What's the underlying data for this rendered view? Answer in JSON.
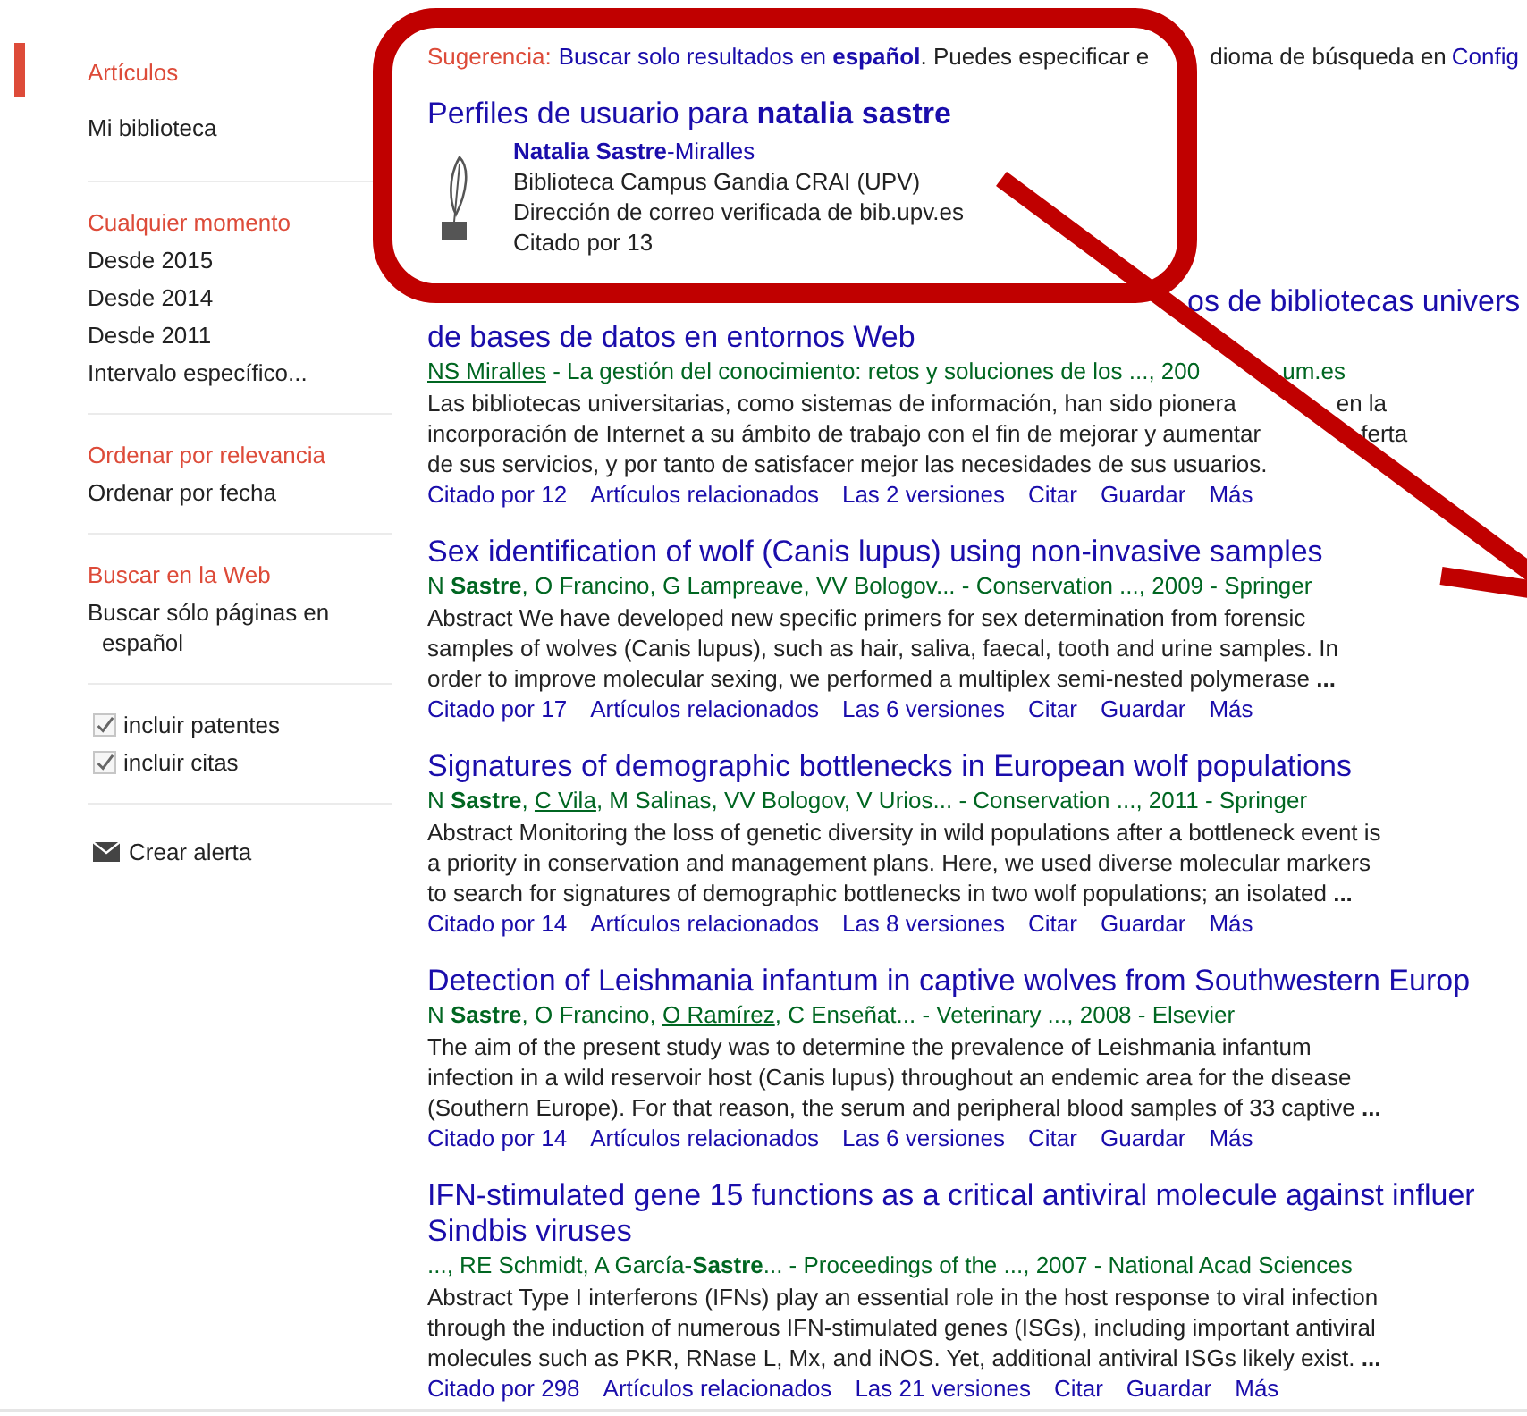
{
  "sidebar": {
    "groups": [
      {
        "items": [
          {
            "label": "Artículos",
            "selected": true
          },
          {
            "label": "Mi biblioteca",
            "selected": false
          }
        ]
      },
      {
        "items": [
          {
            "label": "Cualquier momento",
            "selected": true
          },
          {
            "label": "Desde 2015",
            "selected": false
          },
          {
            "label": "Desde 2014",
            "selected": false
          },
          {
            "label": "Desde 2011",
            "selected": false
          },
          {
            "label": "Intervalo específico...",
            "selected": false
          }
        ]
      },
      {
        "items": [
          {
            "label": "Ordenar por relevancia",
            "selected": true
          },
          {
            "label": "Ordenar por fecha",
            "selected": false
          }
        ]
      },
      {
        "items": [
          {
            "label": "Buscar en la Web",
            "selected": true
          },
          {
            "label": "Buscar sólo páginas en español",
            "selected": false
          }
        ]
      }
    ],
    "checkboxes": [
      {
        "label": "incluir patentes",
        "checked": true
      },
      {
        "label": "incluir citas",
        "checked": true
      }
    ],
    "alert": "Crear alerta"
  },
  "suggestion": {
    "label": "Sugerencia:",
    "link": "Buscar solo resultados en **español**",
    "text": ". Puedes especificar e",
    "text_after_mark": "dioma de búsqueda en",
    "settings_link": "Config"
  },
  "profiles": {
    "title": "Perfiles de usuario para **natalia sastre**",
    "name": "**Natalia Sastre**-Miralles",
    "lines": [
      "Biblioteca Campus Gandia CRAI (UPV)",
      "Dirección de correo verificada de bib.upv.es",
      "Citado por 13"
    ]
  },
  "results": [
    {
      "title_lines": [
        {
          "text": "os de bibliotecas univers",
          "covered": true
        },
        {
          "text": "de bases de datos en entornos Web",
          "covered": false
        }
      ],
      "authors": [
        {
          "kind": "link",
          "text": "NS Miralles"
        },
        {
          "kind": "plain",
          "text": " - La gestión del conocimiento: retos y soluciones de los ..., 200"
        },
        {
          "kind": "after_mark",
          "text": "um.es"
        }
      ],
      "snippet_lines": [
        [
          "Las bibliotecas universitarias, como sistemas de información, han sido pionera",
          "en la"
        ],
        [
          "incorporación de Internet a su ámbito de trabajo con el fin de mejorar y aumentar",
          "ferta"
        ],
        [
          "de sus servicios, y por tanto de satisfacer mejor las necesidades de sus usuarios."
        ]
      ],
      "links": [
        "Citado por 12",
        "Artículos relacionados",
        "Las 2 versiones",
        "Citar",
        "Guardar",
        "Más"
      ]
    },
    {
      "title_lines": [
        {
          "text": "Sex identification of wolf (Canis lupus) using non-invasive samples",
          "covered": false
        }
      ],
      "authors": [
        {
          "kind": "plain",
          "text": "N **Sastre**, O Francino, G Lampreave, VV Bologov... - Conservation ..., 2009 - Springer"
        }
      ],
      "snippet_lines": [
        [
          "Abstract We have developed new specific primers for sex determination from forensic"
        ],
        [
          "samples of wolves (Canis lupus), such as hair, saliva, faecal, tooth and urine samples. In"
        ],
        [
          "order to improve molecular sexing, we performed a multiplex semi-nested polymerase **...**"
        ]
      ],
      "links": [
        "Citado por 17",
        "Artículos relacionados",
        "Las 6 versiones",
        "Citar",
        "Guardar",
        "Más"
      ]
    },
    {
      "title_lines": [
        {
          "text": "Signatures of demographic bottlenecks in European wolf populations",
          "covered": false
        }
      ],
      "authors": [
        {
          "kind": "plain",
          "text": "N **Sastre**, "
        },
        {
          "kind": "link",
          "text": "C Vila"
        },
        {
          "kind": "plain",
          "text": ", M Salinas, VV Bologov, V Urios... - Conservation ..., 2011 - Springer"
        }
      ],
      "snippet_lines": [
        [
          "Abstract Monitoring the loss of genetic diversity in wild populations after a bottleneck event is"
        ],
        [
          "a priority in conservation and management plans. Here, we used diverse molecular markers"
        ],
        [
          "to search for signatures of demographic bottlenecks in two wolf populations; an isolated **...**"
        ]
      ],
      "links": [
        "Citado por 14",
        "Artículos relacionados",
        "Las 8 versiones",
        "Citar",
        "Guardar",
        "Más"
      ]
    },
    {
      "title_lines": [
        {
          "text": "Detection of Leishmania infantum in captive wolves from Southwestern Europ",
          "covered": false
        }
      ],
      "authors": [
        {
          "kind": "plain",
          "text": "N **Sastre**, O Francino, "
        },
        {
          "kind": "link",
          "text": "O Ramírez"
        },
        {
          "kind": "plain",
          "text": ", C Enseñat... - Veterinary ..., 2008 - Elsevier"
        }
      ],
      "snippet_lines": [
        [
          "The aim of the present study was to determine the prevalence of Leishmania infantum"
        ],
        [
          "infection in a wild reservoir host (Canis lupus) throughout an endemic area for the disease"
        ],
        [
          "(Southern Europe). For that reason, the serum and peripheral blood samples of 33 captive **...**"
        ]
      ],
      "links": [
        "Citado por 14",
        "Artículos relacionados",
        "Las 6 versiones",
        "Citar",
        "Guardar",
        "Más"
      ]
    },
    {
      "title_lines": [
        {
          "text": "IFN-stimulated gene 15 functions as a critical antiviral molecule against influer",
          "covered": false
        },
        {
          "text": "Sindbis viruses",
          "covered": false
        }
      ],
      "authors": [
        {
          "kind": "plain",
          "text": "..., RE Schmidt, A García-**Sastre**... - Proceedings of the ..., 2007 - National Acad Sciences"
        }
      ],
      "snippet_lines": [
        [
          "Abstract Type I interferons (IFNs) play an essential role in the host response to viral infection"
        ],
        [
          "through the induction of numerous IFN-stimulated genes (ISGs), including important antiviral"
        ],
        [
          "molecules such as PKR, RNase L, Mx, and iNOS. Yet, additional antiviral ISGs likely exist. **...**"
        ]
      ],
      "links": [
        "Citado por 298",
        "Artículos relacionados",
        "Las 21 versiones",
        "Citar",
        "Guardar",
        "Más"
      ]
    }
  ]
}
